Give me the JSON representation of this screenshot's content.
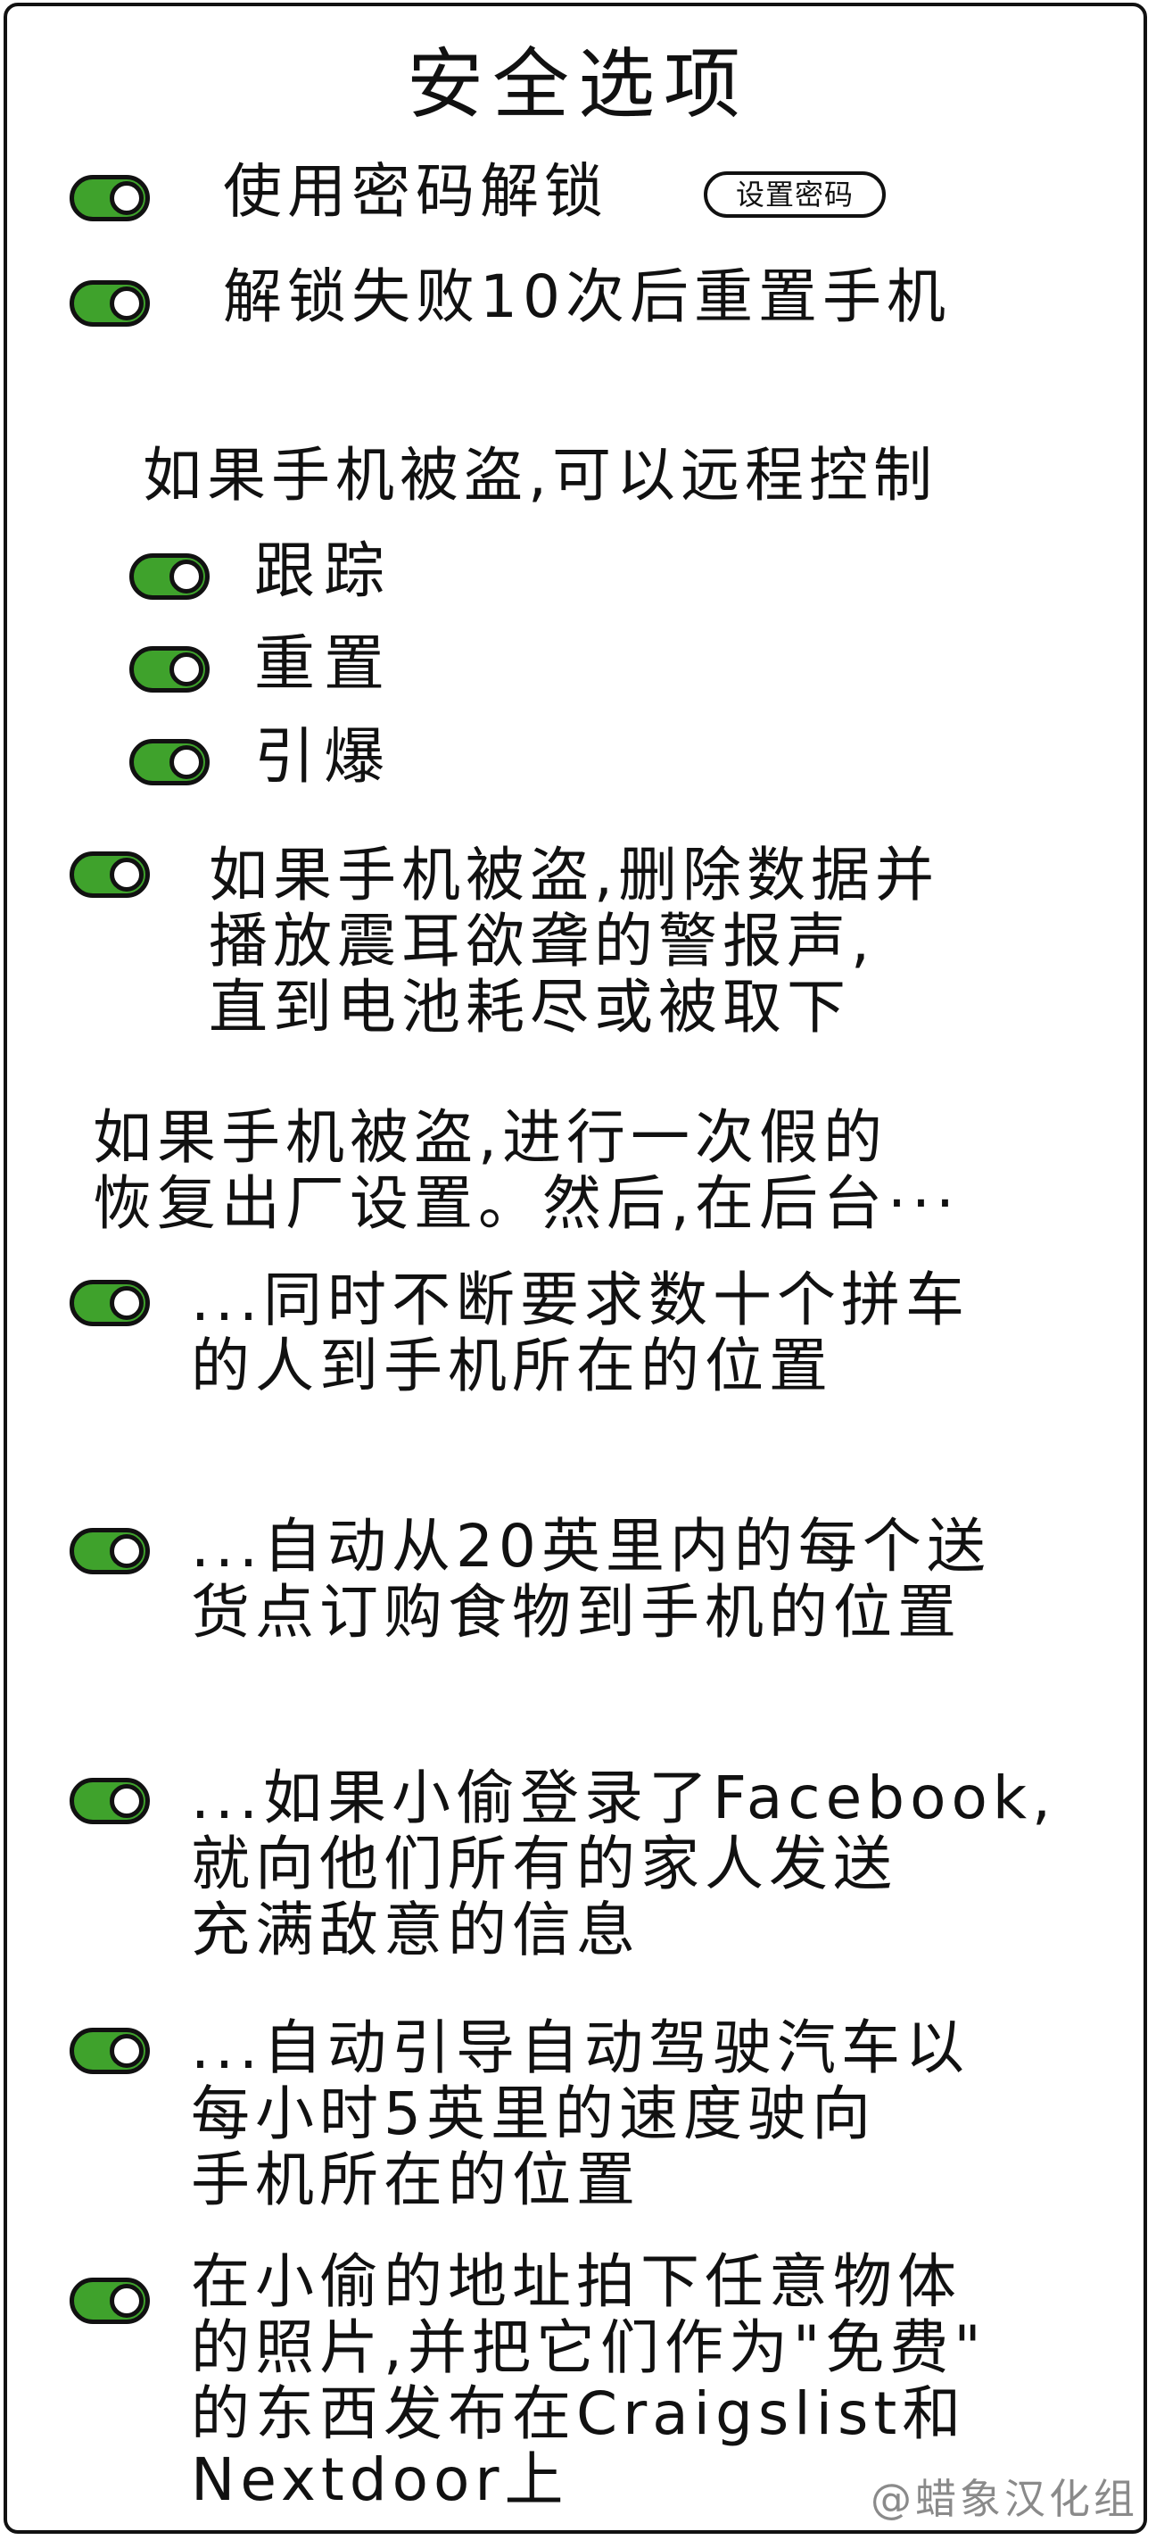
{
  "title": "安全选项",
  "options": [
    {
      "label": "使用密码解锁",
      "on": true
    },
    {
      "label": "解锁失败10次后重置手机",
      "on": true
    }
  ],
  "set_password_button": "设置密码",
  "remote_section": {
    "heading": "如果手机被盗,可以远程控制",
    "items": [
      {
        "label": "跟踪",
        "on": true
      },
      {
        "label": "重置",
        "on": true
      },
      {
        "label": "引爆",
        "on": true
      }
    ]
  },
  "alarm_option": {
    "label": "如果手机被盗,删除数据并\n播放震耳欲聋的警报声,\n直到电池耗尽或被取下",
    "on": true
  },
  "fake_reset_section": {
    "heading": "如果手机被盗,进行一次假的\n恢复出厂设置。然后,在后台···",
    "items": [
      {
        "label": "...同时不断要求数十个拼车\n的人到手机所在的位置",
        "on": true
      },
      {
        "label": "...自动从20英里内的每个送\n货点订购食物到手机的位置",
        "on": true
      },
      {
        "label": "...如果小偷登录了Facebook,\n就向他们所有的家人发送\n充满敌意的信息",
        "on": true
      },
      {
        "label": "...自动引导自动驾驶汽车以\n每小时5英里的速度驶向\n手机所在的位置",
        "on": true
      },
      {
        "label": "在小偷的地址拍下任意物体\n的照片,并把它们作为\"免费\"\n的东西发布在Craigslist和\nNextdoor上",
        "on": true
      }
    ]
  },
  "credit": "@蜡象汉化组",
  "colors": {
    "toggle_on": "#3fa22c",
    "outline": "#111111",
    "credit": "#8a8a8a"
  }
}
